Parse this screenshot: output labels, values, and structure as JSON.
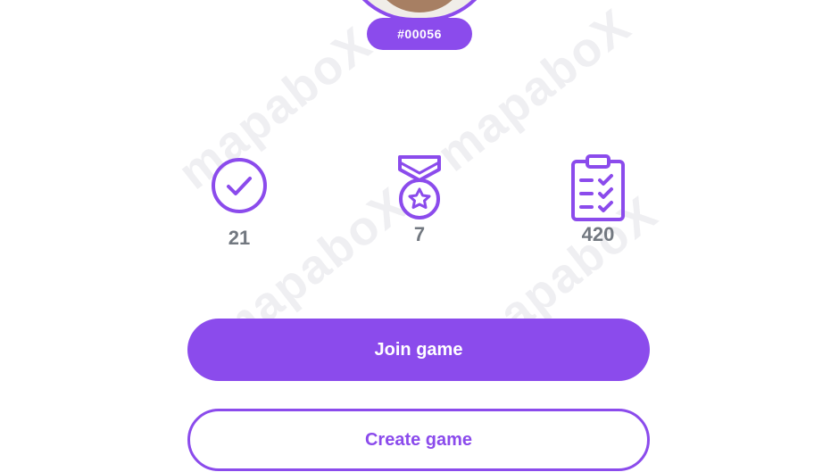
{
  "profile": {
    "user_id": "#00056"
  },
  "stats": [
    {
      "icon": "check-circle-icon",
      "value": "21"
    },
    {
      "icon": "medal-icon",
      "value": "7"
    },
    {
      "icon": "clipboard-checklist-icon",
      "value": "420"
    }
  ],
  "actions": {
    "join_label": "Join game",
    "create_label": "Create game"
  },
  "colors": {
    "accent": "#8b4bec",
    "stat_text": "#727880"
  }
}
